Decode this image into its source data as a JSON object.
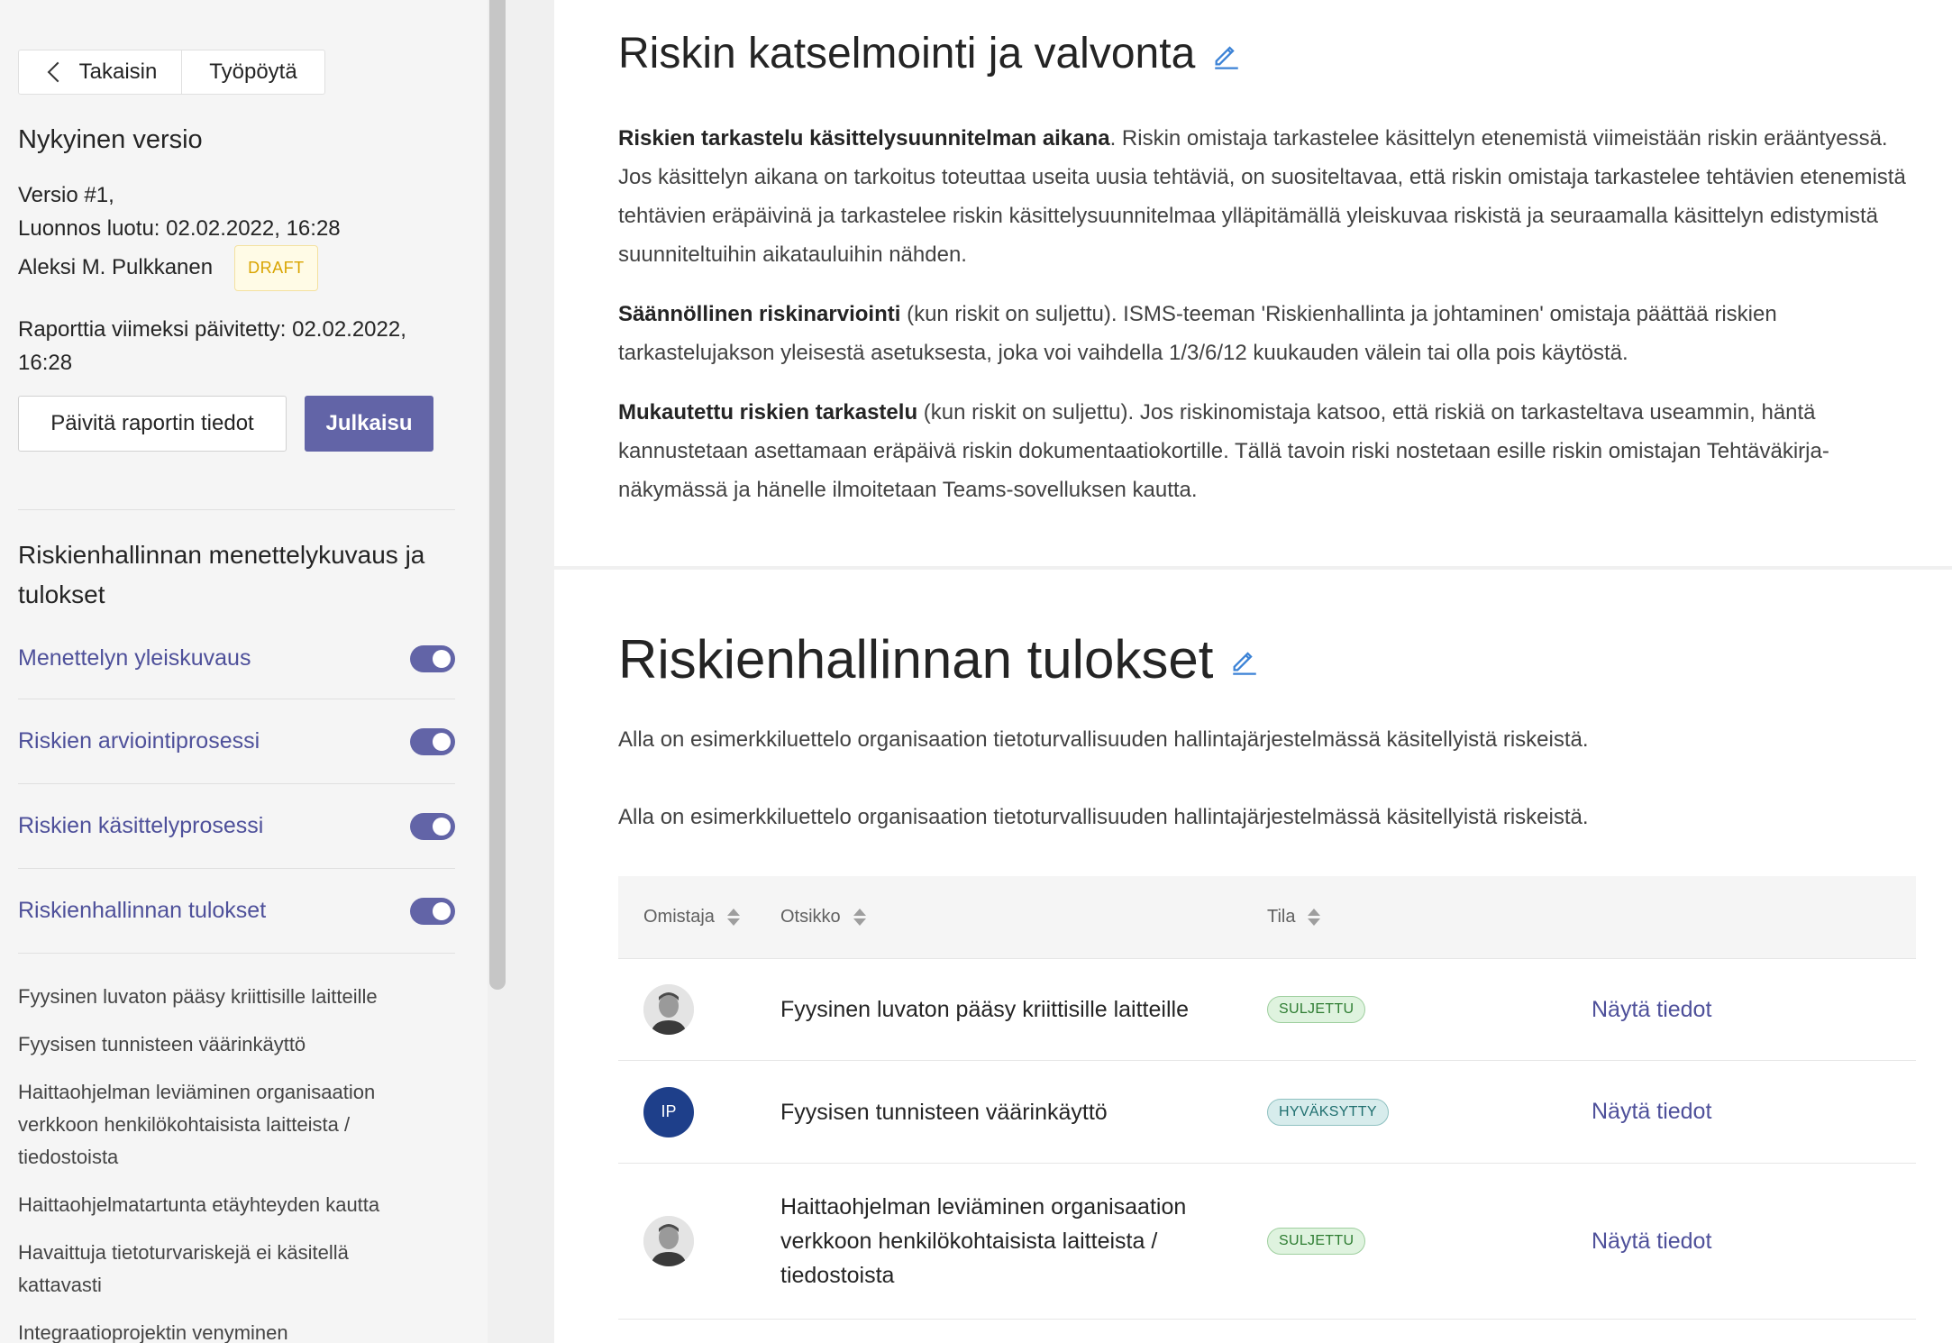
{
  "sidebar": {
    "nav": {
      "back_label": "Takaisin",
      "desktop_label": "Työpöytä"
    },
    "current_version_heading": "Nykyinen versio",
    "version": {
      "line1": "Versio #1,",
      "line2": "Luonnos luotu: 02.02.2022, 16:28",
      "author": "Aleksi M. Pulkkanen",
      "badge": "DRAFT"
    },
    "updated": "Raporttia viimeksi päivitetty: 02.02.2022, 16:28",
    "update_button": "Päivitä raportin tiedot",
    "publish_button": "Julkaisu",
    "section_heading": "Riskienhallinnan menettelykuvaus ja tulokset",
    "toggles": [
      {
        "label": "Menettelyn yleiskuvaus",
        "on": true
      },
      {
        "label": "Riskien arviointiprosessi",
        "on": true
      },
      {
        "label": "Riskien käsittelyprosessi",
        "on": true
      },
      {
        "label": "Riskienhallinnan tulokset",
        "on": true
      }
    ],
    "risks": [
      "Fyysinen luvaton pääsy kriittisille laitteille",
      "Fyysisen tunnisteen väärinkäyttö",
      "Haittaohjelman leviäminen organisaation verkkoon henkilökohtaisista laitteista / tiedostoista",
      "Haittaohjelmatartunta etäyhteyden kautta",
      "Havaittuja tietoturvariskejä ei käsitellä kattavasti",
      "Integraatioprojektin venyminen"
    ]
  },
  "main": {
    "section1": {
      "title": "Riskin katselmointi ja valvonta",
      "p1_bold": "Riskien tarkastelu käsittelysuunnitelman aikana",
      "p1_text": ". Riskin omistaja tarkastelee käsittelyn etenemistä viimeistään riskin erääntyessä. Jos käsittelyn aikana on tarkoitus toteuttaa useita uusia tehtäviä, on suositeltavaa, että riskin omistaja tarkastelee tehtävien etenemistä tehtävien eräpäivinä ja tarkastelee riskin käsittelysuunnitelmaa ylläpitämällä yleiskuvaa riskistä ja seuraamalla käsittelyn edistymistä suunniteltuihin aikatauluihin nähden.",
      "p2_bold": "Säännöllinen riskinarviointi",
      "p2_text": " (kun riskit on suljettu). ISMS-teeman 'Riskienhallinta ja johtaminen' omistaja päättää riskien tarkastelujakson yleisestä asetuksesta, joka voi vaihdella 1/3/6/12 kuukauden välein tai olla pois käytöstä.",
      "p3_bold": "Mukautettu riskien tarkastelu",
      "p3_text": " (kun riskit on suljettu). Jos riskinomistaja katsoo, että riskiä on tarkasteltava useammin, häntä kannustetaan asettamaan eräpäivä riskin dokumentaatiokortille. Tällä tavoin riski nostetaan esille riskin omistajan Tehtäväkirja-näkymässä ja hänelle ilmoitetaan Teams-sovelluksen kautta."
    },
    "section2": {
      "title": "Riskienhallinnan tulokset",
      "intro1": "Alla on esimerkkiluettelo organisaation tietoturvallisuuden hallintajärjestelmässä käsitellyistä riskeistä.",
      "intro2": "Alla on esimerkkiluettelo organisaation tietoturvallisuuden hallintajärjestelmässä käsitellyistä riskeistä.",
      "table": {
        "headers": {
          "owner": "Omistaja",
          "title": "Otsikko",
          "state": "Tila"
        },
        "rows": [
          {
            "owner_type": "photo",
            "owner_initials": "",
            "title": "Fyysinen luvaton pääsy kriittisille laitteille",
            "state": "SULJETTU",
            "state_kind": "closed",
            "action": "Näytä tiedot"
          },
          {
            "owner_type": "initials",
            "owner_initials": "IP",
            "title": "Fyysisen tunnisteen väärinkäyttö",
            "state": "HYVÄKSYTTY",
            "state_kind": "approved",
            "action": "Näytä tiedot"
          },
          {
            "owner_type": "photo",
            "owner_initials": "",
            "title": "Haittaohjelman leviäminen organisaation verkkoon henkilökohtaisista laitteista / tiedostoista",
            "state": "SULJETTU",
            "state_kind": "closed",
            "action": "Näytä tiedot"
          }
        ]
      }
    }
  },
  "colors": {
    "accent": "#6264a7",
    "link": "#4e509a",
    "draft": "#d9a400"
  }
}
